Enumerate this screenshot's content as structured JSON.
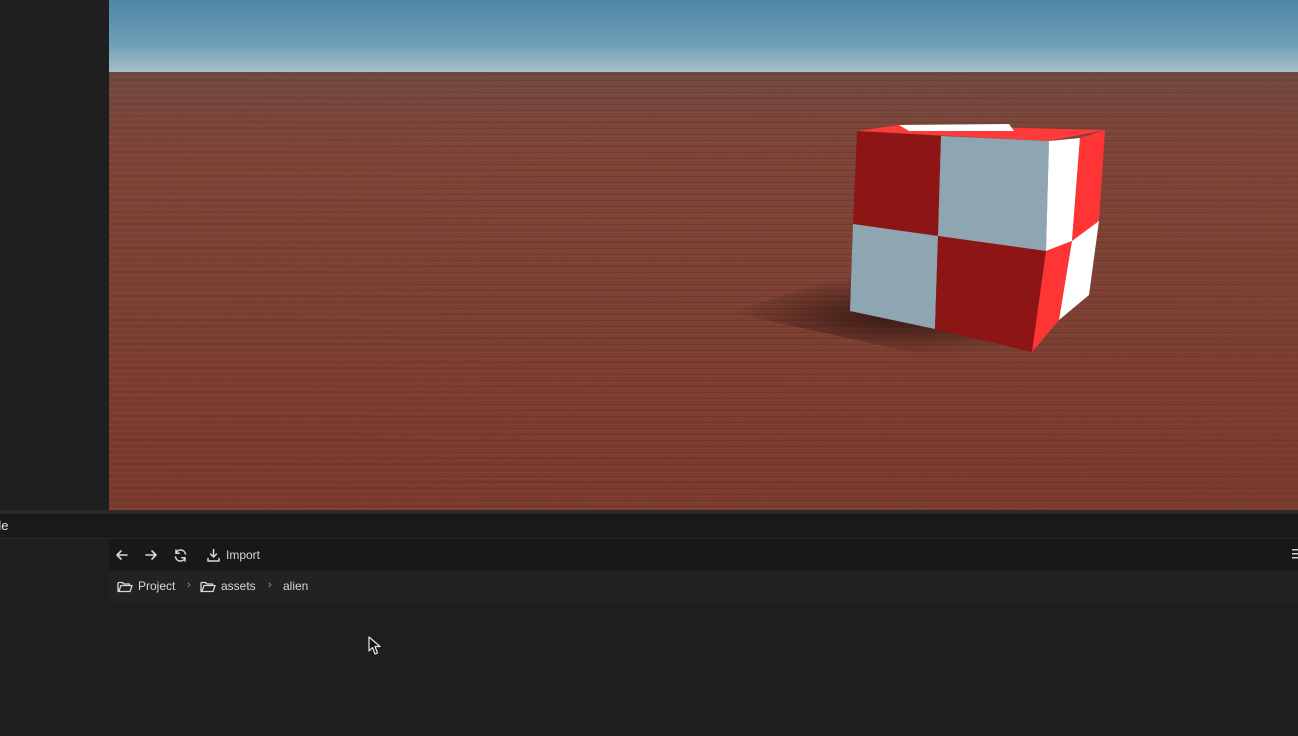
{
  "panel": {
    "tab_label": "de"
  },
  "toolbar": {
    "back_icon": "arrow-left-icon",
    "forward_icon": "arrow-right-icon",
    "refresh_icon": "refresh-icon",
    "import_icon": "download-icon",
    "import_label": "Import"
  },
  "breadcrumb": {
    "items": [
      {
        "label": "Project",
        "icon": "folder-open-icon"
      },
      {
        "label": "assets",
        "icon": "folder-open-icon"
      },
      {
        "label": "alien"
      }
    ],
    "separator": "›"
  },
  "colors": {
    "sky_top": "#5b8fb0",
    "ground": "#7a3f33",
    "cube_red": "#8e1515",
    "cube_light": "#8ea5b2",
    "cube_side_red": "#ff3030",
    "cube_white": "#ffffff",
    "panel_bg": "#1e1e1e"
  }
}
